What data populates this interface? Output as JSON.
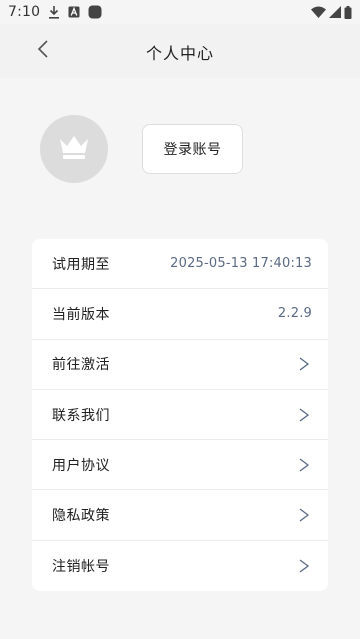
{
  "status_bar": {
    "time": "7:10",
    "icons_left": [
      "download-icon",
      "a-box-icon",
      "app-badge-icon"
    ],
    "icons_right": [
      "wifi-icon",
      "signal-icon",
      "battery-icon"
    ]
  },
  "header": {
    "title": "个人中心",
    "back_icon": "chevron-left-icon"
  },
  "profile": {
    "avatar_icon": "crown-icon",
    "login_label": "登录账号"
  },
  "menu": {
    "trial": {
      "label": "试用期至",
      "value": "2025-05-13 17:40:13"
    },
    "version": {
      "label": "当前版本",
      "value": "2.2.9"
    },
    "activate": {
      "label": "前往激活",
      "arrow": ">"
    },
    "contact": {
      "label": "联系我们",
      "arrow": ">"
    },
    "agreement": {
      "label": "用户协议",
      "arrow": ">"
    },
    "privacy": {
      "label": "隐私政策",
      "arrow": ">"
    },
    "cancel": {
      "label": "注销帐号",
      "arrow": ">"
    }
  },
  "colors": {
    "background": "#f5f5f5",
    "card": "#ffffff",
    "value_text": "#5b6a85",
    "avatar_bg": "#dcdcdc"
  }
}
